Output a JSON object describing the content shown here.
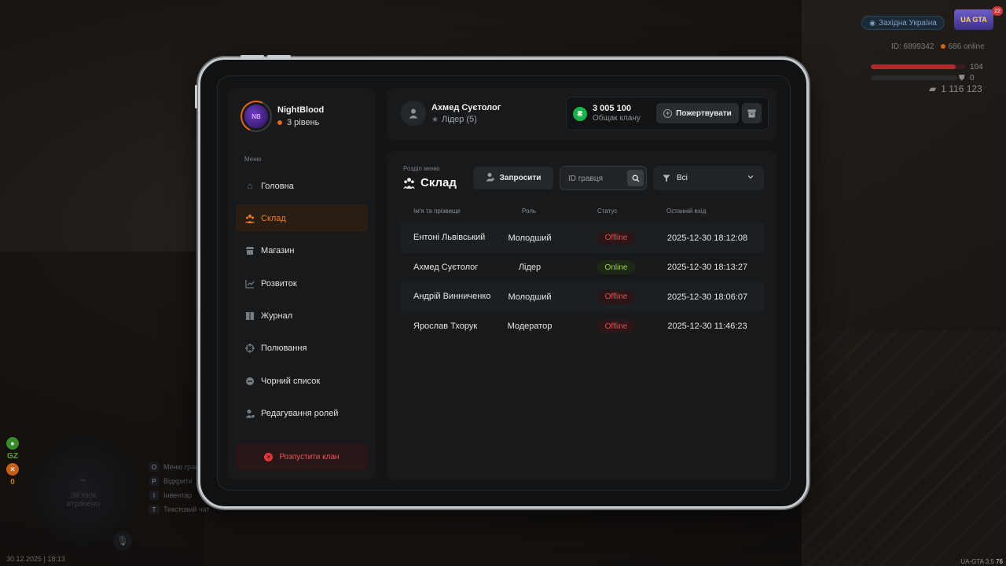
{
  "hud": {
    "region": "Західна Україна",
    "logo_text": "UA GTA",
    "badge": "22",
    "player_id": "ID: 6899342",
    "online": "686 online",
    "health_value": "104",
    "health_fraction": 0.9,
    "armor_value": "0",
    "money": "1 116 123",
    "gz_label": "GZ",
    "zero_label": "0",
    "minimap_text": "Зв'язок втрачено",
    "hints": [
      {
        "key": "O",
        "label": "Меню гравця"
      },
      {
        "key": "P",
        "label": "Відкрити"
      },
      {
        "key": "I",
        "label": "Інвентар"
      },
      {
        "key": "T",
        "label": "Текстовий чат"
      }
    ],
    "mic_key": "B",
    "datetime": "30.12.2025 | 18:13",
    "version": "UA-GTA 3.5",
    "version_extra": "76"
  },
  "clan": {
    "name": "NightBlood",
    "level": "3 рівень",
    "avatar_text": "NB"
  },
  "menu": {
    "caption": "Меню",
    "items": [
      {
        "label": "Головна",
        "icon": "home-icon"
      },
      {
        "label": "Склад",
        "icon": "members-icon",
        "active": true
      },
      {
        "label": "Магазин",
        "icon": "shop-icon"
      },
      {
        "label": "Розвиток",
        "icon": "chart-icon"
      },
      {
        "label": "Журнал",
        "icon": "book-icon"
      },
      {
        "label": "Полювання",
        "icon": "crosshair-icon"
      },
      {
        "label": "Чорний список",
        "icon": "blocked-icon"
      },
      {
        "label": "Редагування ролей",
        "icon": "user-edit-icon"
      }
    ],
    "disband_label": "Розпустити клан"
  },
  "user": {
    "name": "Ахмед Суєтолог",
    "role": "Лідер (5)"
  },
  "treasury": {
    "amount": "3 005 100",
    "caption": "Общак клану",
    "donate_label": "Пожертвувати"
  },
  "section": {
    "caption": "Розділ меню",
    "title": "Склад",
    "invite_label": "Запросити",
    "id_placeholder": "ID гравця",
    "filter_value": "Всі"
  },
  "table": {
    "headers": {
      "name": "Ім'я та прізвище",
      "role": "Роль",
      "status": "Статус",
      "last_login": "Останній вхід"
    },
    "rows": [
      {
        "name": "Ентоні Львівський",
        "role": "Молодший",
        "status": "Offline",
        "last_login": "2025-12-30 18:12:08"
      },
      {
        "name": "Ахмед Суєтолог",
        "role": "Лідер",
        "status": "Online",
        "last_login": "2025-12-30 18:13:27"
      },
      {
        "name": "Андрій Винниченко",
        "role": "Молодший",
        "status": "Offline",
        "last_login": "2025-12-30 18:06:07"
      },
      {
        "name": "Ярослав Тхорук",
        "role": "Модератор",
        "status": "Offline",
        "last_login": "2025-12-30 11:46:23"
      }
    ]
  },
  "colors": {
    "accent": "#f07a24",
    "online": "#9ad05a",
    "offline": "#e0504e",
    "money": "#18b24a"
  }
}
